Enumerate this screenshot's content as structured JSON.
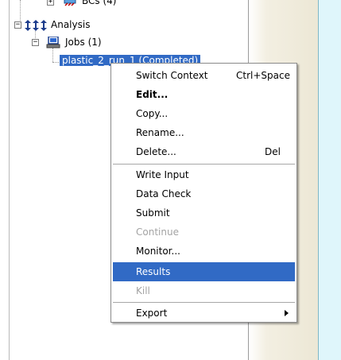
{
  "tree": {
    "bcs_label": "BCs (4)",
    "analysis_label": "Analysis",
    "jobs_label": "Jobs (1)",
    "selected_node_label": "plastic_2_run_1 (Completed)"
  },
  "context_menu": {
    "items": [
      {
        "label": "Switch Context",
        "shortcut": "Ctrl+Space"
      },
      {
        "label": "Edit..."
      },
      {
        "label": "Copy..."
      },
      {
        "label": "Rename..."
      },
      {
        "label": "Delete...",
        "shortcut": "Del"
      },
      {
        "label": "Write Input"
      },
      {
        "label": "Data Check"
      },
      {
        "label": "Submit"
      },
      {
        "label": "Continue"
      },
      {
        "label": "Monitor..."
      },
      {
        "label": "Results"
      },
      {
        "label": "Kill"
      },
      {
        "label": "Export"
      }
    ]
  },
  "colors": {
    "selection": "#316ac5",
    "side_panel": "#ece7d5",
    "right_strip": "#dff6fb"
  }
}
